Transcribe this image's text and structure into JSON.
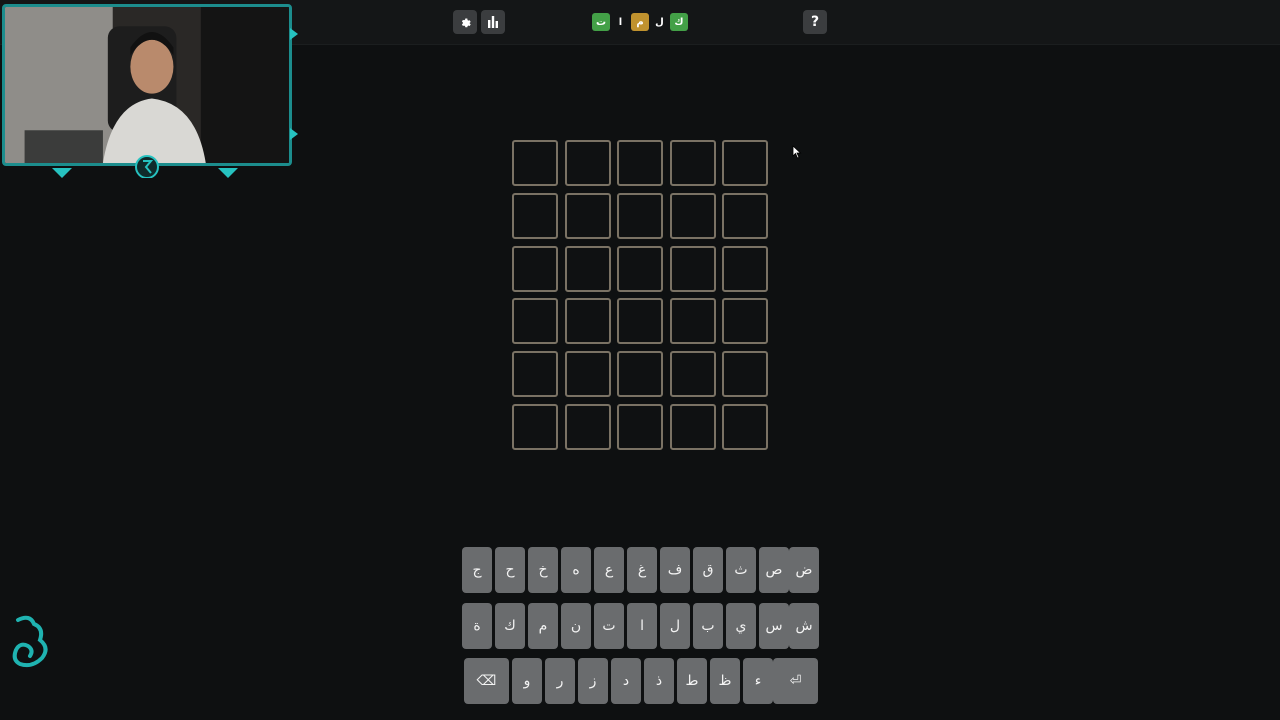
{
  "topbar": {
    "settings_icon": "gear-icon",
    "stats_icon": "bar-chart-icon",
    "help_label": "?",
    "logo_letters": [
      {
        "char": "ت",
        "state": "correct"
      },
      {
        "char": "ا",
        "state": "plain"
      },
      {
        "char": "م",
        "state": "present"
      },
      {
        "char": "ل",
        "state": "plain"
      },
      {
        "char": "ك",
        "state": "correct"
      }
    ]
  },
  "board": {
    "rows": 6,
    "cols": 5
  },
  "keyboard": {
    "row1": [
      "ض",
      "ص",
      "ث",
      "ق",
      "ف",
      "غ",
      "ع",
      "ه",
      "خ",
      "ح",
      "ج"
    ],
    "row2": [
      "ش",
      "س",
      "ي",
      "ب",
      "ل",
      "ا",
      "ت",
      "ن",
      "م",
      "ك",
      "ة"
    ],
    "row3": [
      "⏎",
      "ء",
      "ظ",
      "ط",
      "ذ",
      "د",
      "ز",
      "ر",
      "و",
      "⌫"
    ]
  },
  "colors": {
    "correct": "#43a047",
    "present": "#c0922e",
    "tile_border": "#7a7264",
    "key_bg": "#6a6c6e",
    "accent": "#1c8d8d"
  }
}
